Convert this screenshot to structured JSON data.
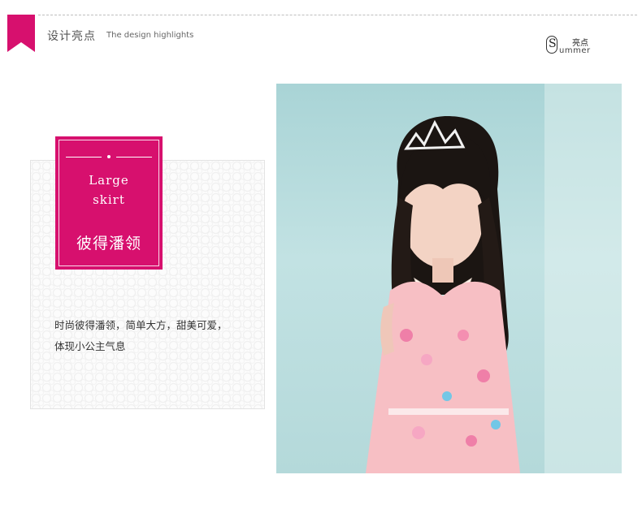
{
  "header": {
    "title": "设计亮点",
    "subtitle": "The design highlights"
  },
  "logo": {
    "letter": "S",
    "cn": "亮点",
    "en": "ummer"
  },
  "card": {
    "en_line1": "Large",
    "en_line2": "skirt",
    "cn_title": "彼得潘领"
  },
  "description": {
    "line1": "时尚彼得潘领，简单大方，甜美可爱，",
    "line2": "体现小公主气息"
  },
  "colors": {
    "accent": "#d7106e",
    "photo_background": "#b8dcdd"
  }
}
